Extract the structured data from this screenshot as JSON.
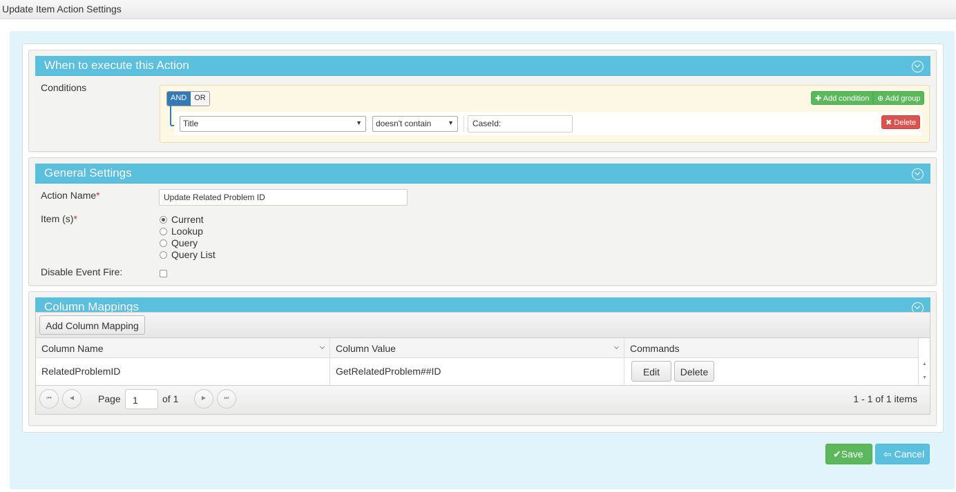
{
  "window": {
    "title": "Update Item Action Settings"
  },
  "conditions_section": {
    "title": "When to execute this Action",
    "label": "Conditions",
    "and_label": "AND",
    "or_label": "OR",
    "add_condition": "Add condition",
    "add_group": "Add group",
    "rule": {
      "field": "Title",
      "operator": "doesn't contain",
      "value": "CaseId:"
    },
    "delete_label": "Delete"
  },
  "general_section": {
    "title": "General Settings",
    "action_name_label": "Action Name",
    "action_name_value": "Update Related Problem ID",
    "items_label": "Item (s)",
    "items_options": [
      "Current",
      "Lookup",
      "Query",
      "Query List"
    ],
    "items_selected": "Current",
    "disable_event_label": "Disable Event Fire:",
    "required_mark": "*"
  },
  "mappings_section": {
    "title": "Column Mappings",
    "add_button": "Add Column Mapping",
    "columns": [
      "Column Name",
      "Column Value",
      "Commands"
    ],
    "rows": [
      {
        "name": "RelatedProblemID",
        "value": "GetRelatedProblem##ID",
        "edit": "Edit",
        "delete": "Delete"
      }
    ],
    "pager": {
      "page_label": "Page",
      "page_value": "1",
      "of_label": "of 1",
      "summary": "1 - 1 of 1 items"
    }
  },
  "footer": {
    "save": "Save",
    "cancel": "Cancel"
  }
}
